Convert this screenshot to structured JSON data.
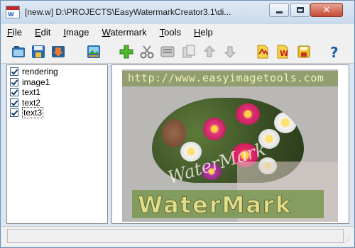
{
  "window": {
    "title": "[new.w] D:\\PROJECTS\\EasyWatermarkCreator3.1\\di...",
    "app_icon_text": "W"
  },
  "menu": [
    {
      "pre": "",
      "ul": "F",
      "post": "ile"
    },
    {
      "pre": "",
      "ul": "E",
      "post": "dit"
    },
    {
      "pre": "",
      "ul": "I",
      "post": "mage"
    },
    {
      "pre": "",
      "ul": "W",
      "post": "atermark"
    },
    {
      "pre": "",
      "ul": "T",
      "post": "ools"
    },
    {
      "pre": "",
      "ul": "H",
      "post": "elp"
    }
  ],
  "toolbar": {
    "icons": [
      "open-folder-icon",
      "save-icon",
      "import-icon",
      "image-icon",
      "add-icon",
      "cut-icon",
      "text-icon",
      "copy-icon",
      "move-up-icon",
      "move-down-icon",
      "export-icon",
      "watermark-icon",
      "save-watermark-icon",
      "help-icon"
    ]
  },
  "layers": [
    {
      "label": "rendering",
      "checked": true
    },
    {
      "label": "image1",
      "checked": true
    },
    {
      "label": "text1",
      "checked": true
    },
    {
      "label": "text2",
      "checked": true
    },
    {
      "label": "text3",
      "checked": true
    }
  ],
  "canvas": {
    "url_watermark": "http://www.easyimagetools.com",
    "diagonal_watermark": "WaterMark",
    "big_watermark": "WaterMark"
  },
  "colors": {
    "window_frame": "#dbe6f2",
    "close_button": "#c44b33",
    "watermark_band": "#86965a",
    "watermark_text": "#dede8c"
  }
}
